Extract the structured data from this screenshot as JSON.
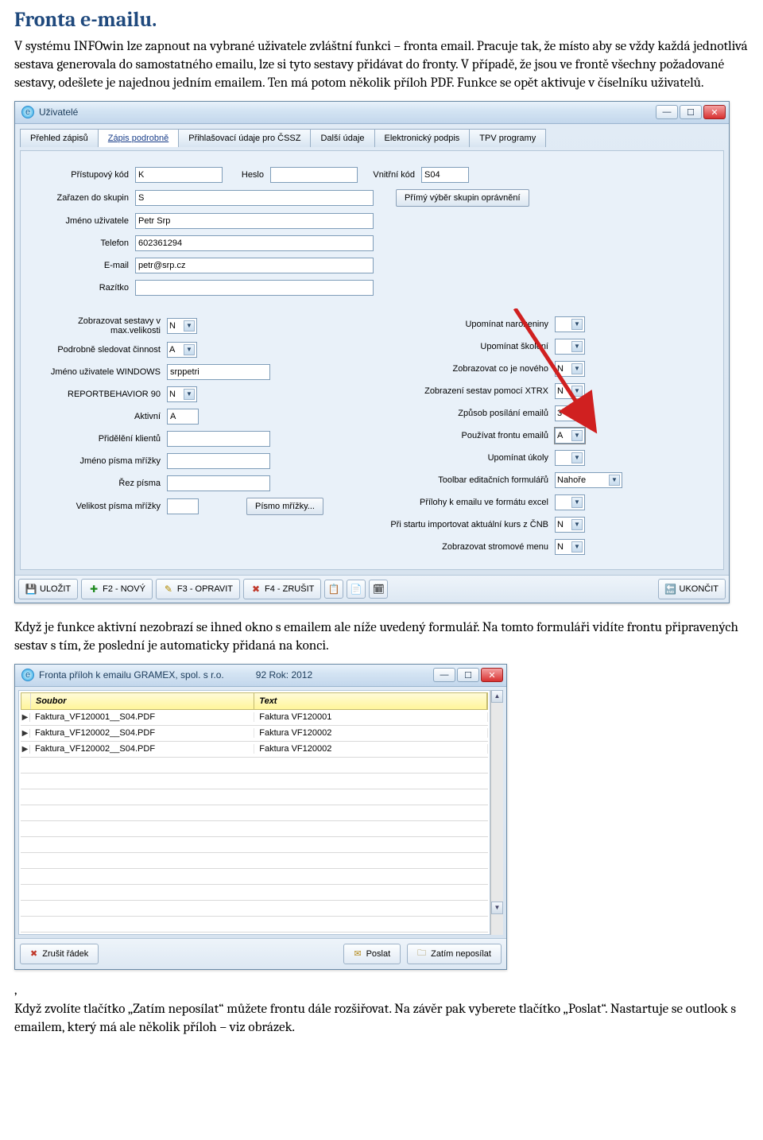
{
  "doc": {
    "title": "Fronta e-mailu.",
    "para1": "V systému INFOwin lze zapnout na vybrané uživatele zvláštní funkci – fronta email. Pracuje tak, že místo aby se vždy každá jednotlivá sestava generovala do samostatného emailu, lze si tyto sestavy přidávat do fronty. V případě, že jsou ve frontě všechny požadované sestavy, odešlete je najednou jedním emailem. Ten má potom několik příloh PDF. Funkce se opět aktivuje v číselníku uživatelů.",
    "para2": "Když je funkce aktivní nezobrazí se ihned okno s emailem ale níže uvedený formulář. Na tomto formuláři vidíte frontu připravených sestav s tím, že poslední je automaticky přidaná na konci.",
    "comma": ",",
    "para3": "Když zvolíte tlačítko „Zatím neposílat“ můžete frontu dále rozšiřovat. Na závěr pak vyberete tlačítko „Poslat“. Nastartuje se outlook s emailem, který má ale několik příloh – viz obrázek."
  },
  "win1": {
    "title": "Uživatelé",
    "tabs": [
      "Přehled zápisů",
      "Zápis podrobně",
      "Přihlašovací údaje pro ČSSZ",
      "Další údaje",
      "Elektronický podpis",
      "TPV programy"
    ],
    "activeTab": 1,
    "top": {
      "kod_lbl": "Přístupový kód",
      "kod_val": "K",
      "heslo_lbl": "Heslo",
      "heslo_val": "",
      "vnitrni_lbl": "Vnitřní kód",
      "vnitrni_val": "S04",
      "skupin_lbl": "Zařazen do skupin",
      "skupin_val": "S",
      "primy_btn": "Přímý výběr skupin oprávnění",
      "jmeno_lbl": "Jméno uživatele",
      "jmeno_val": "Petr Srp",
      "telefon_lbl": "Telefon",
      "telefon_val": "602361294",
      "email_lbl": "E-mail",
      "email_val": "petr@srp.cz",
      "razitko_lbl": "Razítko",
      "razitko_val": ""
    },
    "left": [
      {
        "lbl": "Zobrazovat sestavy v max.velikosti",
        "val": "N",
        "dd": true
      },
      {
        "lbl": "Podrobně sledovat činnost",
        "val": "A",
        "dd": true
      },
      {
        "lbl": "Jméno uživatele WINDOWS",
        "val": "srppetri",
        "dd": false
      },
      {
        "lbl": "REPORTBEHAVIOR 90",
        "val": "N",
        "dd": true
      },
      {
        "lbl": "Aktivní",
        "val": "A",
        "dd": false,
        "short": true
      },
      {
        "lbl": "Přidělění klientů",
        "val": "",
        "dd": false
      },
      {
        "lbl": "Jméno písma mřížky",
        "val": "",
        "dd": false
      },
      {
        "lbl": "Řez písma",
        "val": "",
        "dd": false
      },
      {
        "lbl": "Velikost písma mřížky",
        "val": "",
        "dd": false,
        "short": true
      }
    ],
    "pismo_btn": "Písmo mřížky...",
    "right": [
      {
        "lbl": "Upomínat narozeniny",
        "val": "",
        "dd": true
      },
      {
        "lbl": "Upomínat školení",
        "val": "",
        "dd": true
      },
      {
        "lbl": "Zobrazovat co je nového",
        "val": "N",
        "dd": true
      },
      {
        "lbl": "Zobrazení sestav pomocí XTRX",
        "val": "N",
        "dd": true
      },
      {
        "lbl": "Způsob posílání emailů",
        "val": "3",
        "dd": true
      },
      {
        "lbl": "Používat frontu emailů",
        "val": "A",
        "dd": true,
        "highlight": true
      },
      {
        "lbl": "Upomínat úkoly",
        "val": "",
        "dd": true
      },
      {
        "lbl": "Toolbar editačních formulářů",
        "val": "Nahoře",
        "dd": true,
        "lg": true
      },
      {
        "lbl": "Přílohy k emailu ve formátu excel",
        "val": "",
        "dd": true
      },
      {
        "lbl": "Při startu importovat aktuální kurs z ČNB",
        "val": "N",
        "dd": true
      },
      {
        "lbl": "Zobrazovat stromové menu",
        "val": "N",
        "dd": true
      }
    ],
    "status": {
      "save": "ULOŽIT",
      "new": "F2 - NOVÝ",
      "edit": "F3 - OPRAVIT",
      "cancel": "F4 - ZRUŠIT",
      "exit": "UKONČIT"
    }
  },
  "win2": {
    "title_a": "Fronta příloh k emailu  GRAMEX, spol. s r.o.",
    "title_b": "92  Rok: 2012",
    "head": {
      "c1": "Soubor",
      "c2": "Text"
    },
    "rows": [
      {
        "c1": "Faktura_VF120001__S04.PDF",
        "c2": "Faktura VF120001"
      },
      {
        "c1": "Faktura_VF120002__S04.PDF",
        "c2": "Faktura VF120002"
      },
      {
        "c1": "Faktura_VF120002__S04.PDF",
        "c2": "Faktura VF120002"
      }
    ],
    "btns": {
      "zrusit": "Zrušit řádek",
      "poslat": "Poslat",
      "zatim": "Zatím neposílat"
    }
  }
}
